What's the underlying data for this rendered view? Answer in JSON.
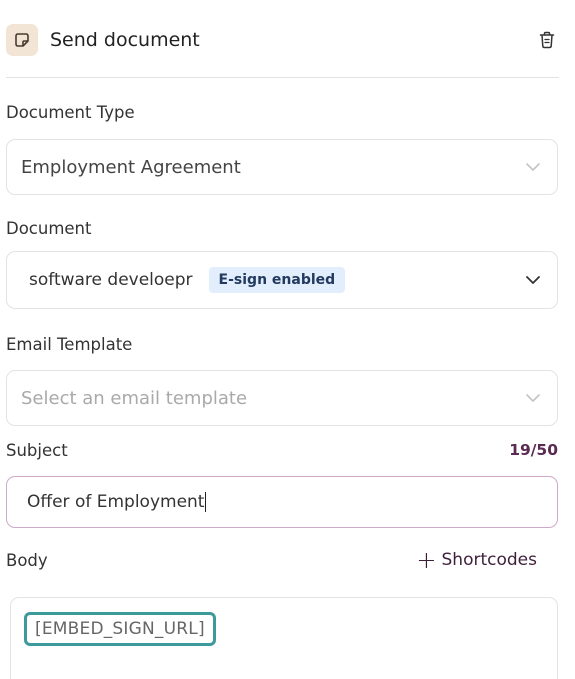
{
  "header": {
    "title": "Send document",
    "icon": "document-fold-icon",
    "delete_icon": "trash-icon"
  },
  "document_type": {
    "label": "Document Type",
    "value": "Employment Agreement"
  },
  "document": {
    "label": "Document",
    "value": "software develoepr",
    "badge": "E-sign enabled"
  },
  "email_template": {
    "label": "Email Template",
    "placeholder": "Select an email template"
  },
  "subject": {
    "label": "Subject",
    "counter": "19/50",
    "value": "Offer of Employment"
  },
  "body": {
    "label": "Body",
    "shortcodes_label": "Shortcodes",
    "embed_token": "[EMBED_SIGN_URL]"
  },
  "colors": {
    "accent": "#5b2a52",
    "badge_bg": "#e3eefc",
    "highlight": "#3d9a9b",
    "icon_bg": "#f3e5d6"
  }
}
